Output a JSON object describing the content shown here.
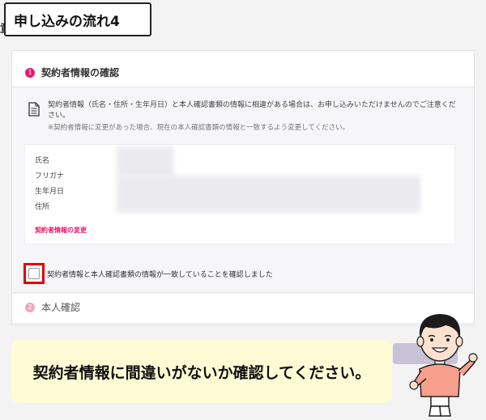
{
  "page": {
    "side_char": "章",
    "title": "申し込みの流れ4"
  },
  "step1": {
    "number": "1",
    "title": "契約者情報の確認",
    "notice": "契約者情報（氏名・住所・生年月日）と本人確認書類の情報に相違がある場合は、お申し込みいただけませんのでご注意ください。",
    "sub_notice": "※契約者情報に変更があった場合、現在の本人確認書類の情報と一致するよう変更してください。",
    "fields": [
      {
        "label": "氏名"
      },
      {
        "label": "フリガナ"
      },
      {
        "label": "生年月日"
      },
      {
        "label": "住所"
      }
    ],
    "change_link": "契約者情報の変更",
    "checkbox_label": "契約者情報と本人確認書類の情報が一致していることを確認しました"
  },
  "step2": {
    "number": "2",
    "title": "本人確認"
  },
  "speech": {
    "text": "契約者情報に間違いがないか確認してください。"
  },
  "colors": {
    "accent": "#e8196f",
    "highlight": "#e00000",
    "speech_bg": "#fffbd4"
  }
}
